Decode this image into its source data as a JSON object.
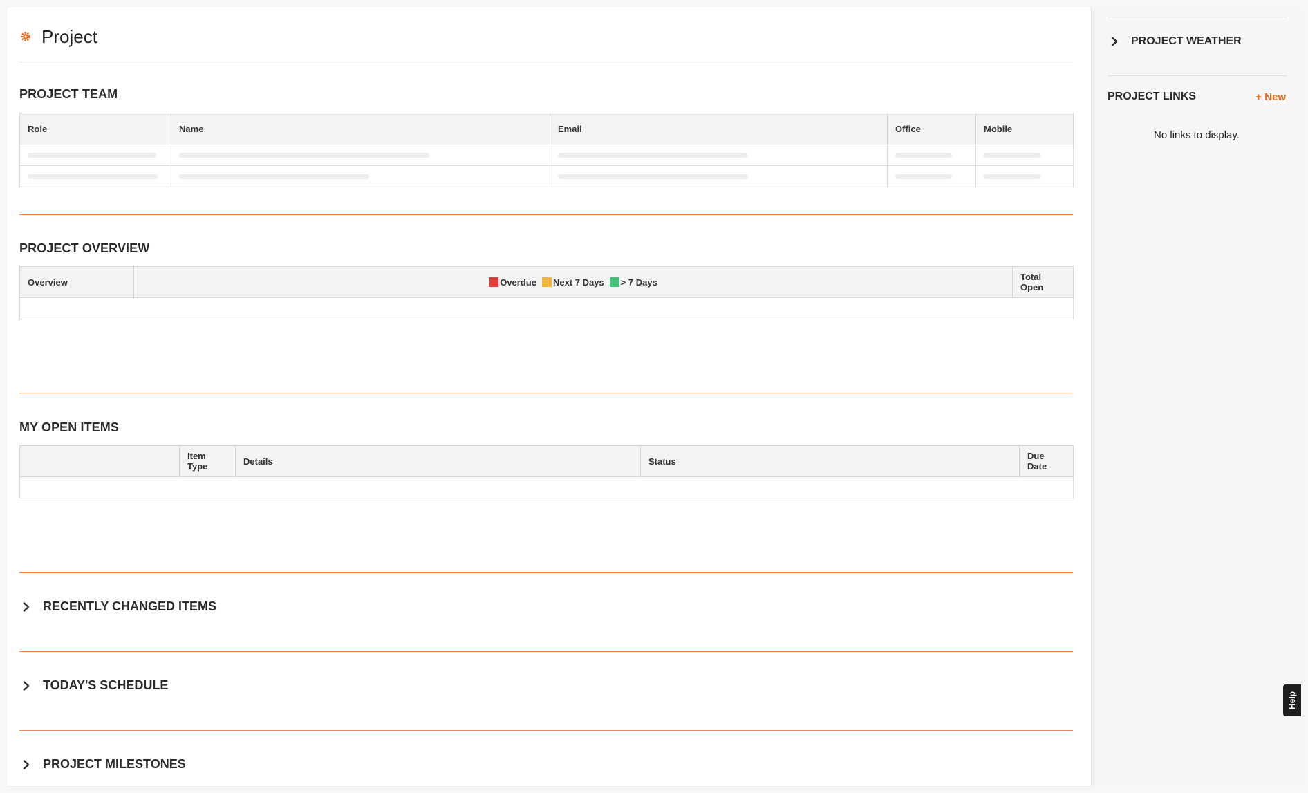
{
  "header": {
    "title": "Project"
  },
  "team": {
    "title": "PROJECT TEAM",
    "columns": [
      "Role",
      "Name",
      "Email",
      "Office",
      "Mobile"
    ]
  },
  "overview": {
    "title": "PROJECT OVERVIEW",
    "col_overview": "Overview",
    "col_total": "Total Open",
    "legend": [
      {
        "label": "Overdue",
        "color": "#e03c3c"
      },
      {
        "label": "Next 7 Days",
        "color": "#f0b53a"
      },
      {
        "label": "> 7 Days",
        "color": "#45c07a"
      }
    ]
  },
  "open_items": {
    "title": "MY OPEN ITEMS",
    "columns": [
      "",
      "Item Type",
      "Details",
      "Status",
      "Due Date"
    ]
  },
  "collapsed_sections": [
    {
      "label": "RECENTLY CHANGED ITEMS"
    },
    {
      "label": "TODAY'S SCHEDULE"
    },
    {
      "label": "PROJECT MILESTONES"
    }
  ],
  "sidebar": {
    "weather": "PROJECT WEATHER",
    "links_title": "PROJECT LINKS",
    "new_label": "+ New",
    "no_links": "No links to display."
  },
  "help": {
    "label": "Help"
  },
  "colors": {
    "accent": "#f26b1d",
    "divider": "#f2844a"
  }
}
